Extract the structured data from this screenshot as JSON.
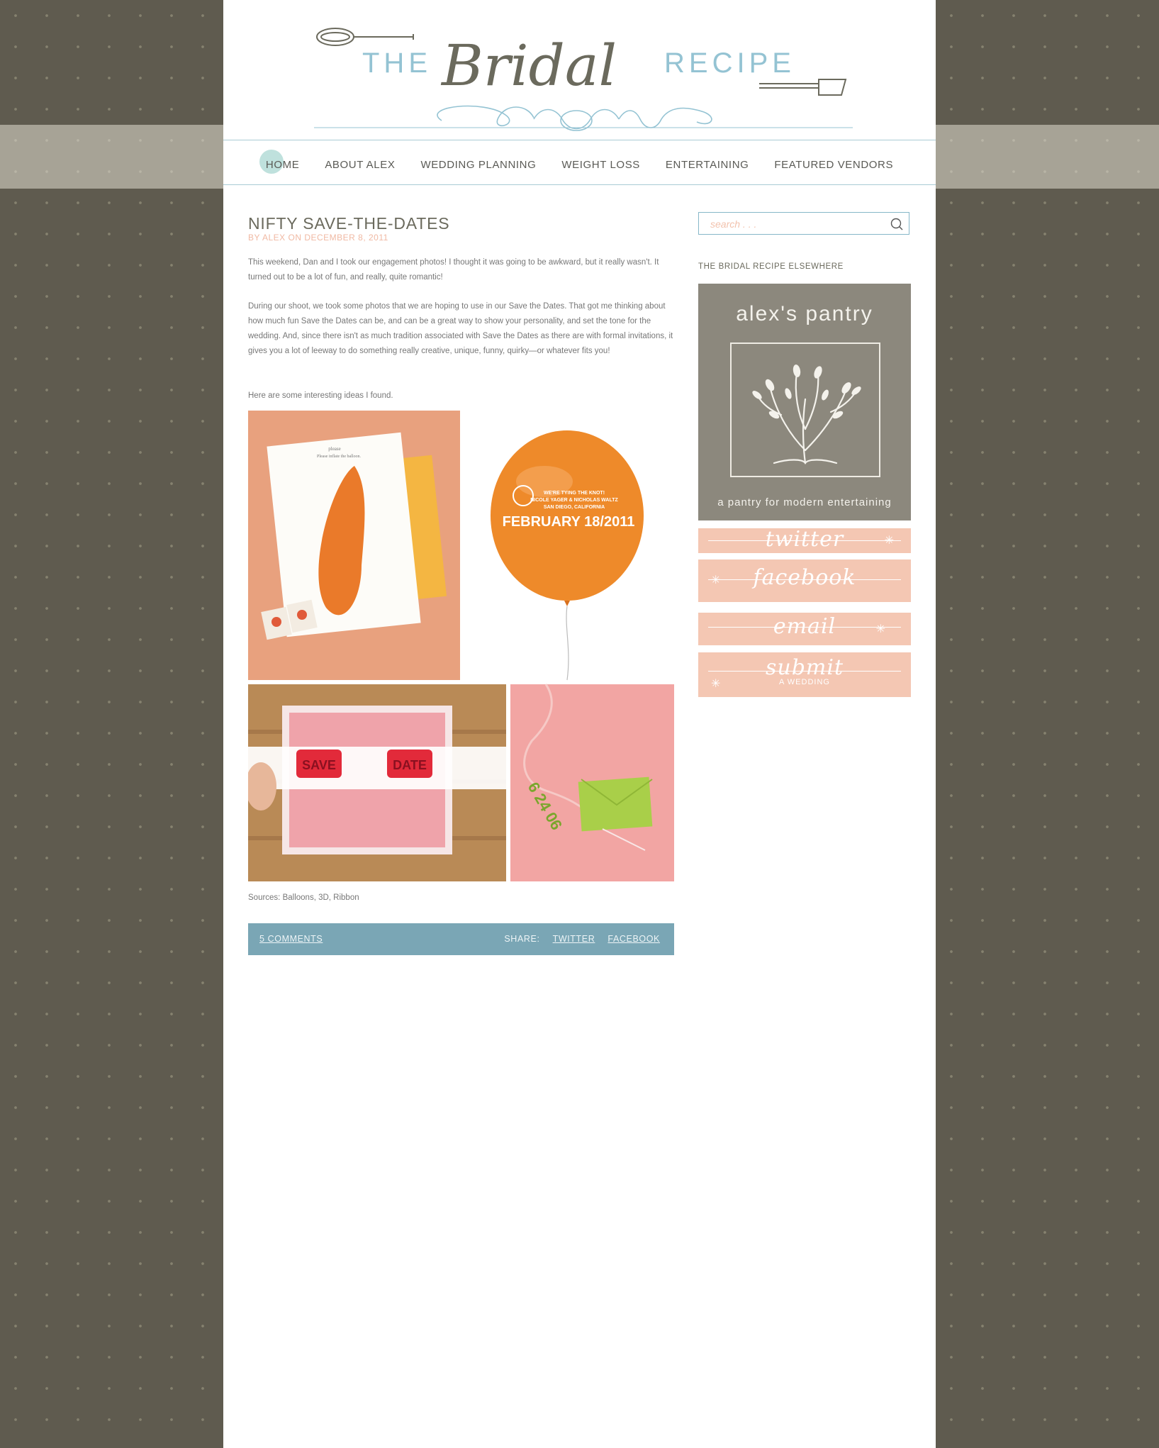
{
  "site": {
    "title_left": "THE",
    "title_script": "Bridal",
    "title_right": "RECIPE"
  },
  "nav": {
    "items": [
      {
        "label": "HOME"
      },
      {
        "label": "ABOUT ALEX"
      },
      {
        "label": "WEDDING PLANNING"
      },
      {
        "label": "WEIGHT LOSS"
      },
      {
        "label": "ENTERTAINING"
      },
      {
        "label": "FEATURED VENDORS"
      }
    ]
  },
  "post": {
    "title": "NIFTY SAVE-THE-DATES",
    "byline": "BY ALEX ON DECEMBER 8, 2011",
    "paragraphs": [
      "This weekend, Dan and I took our engagement photos! I thought it was going to be awkward, but it really wasn't. It turned out to be a lot of fun, and really, quite romantic!",
      "During our shoot, we took some photos that we are hoping to use in our Save the Dates. That got me thinking about how much fun Save the Dates can be, and can be a great way to show your personality, and set the tone for the wedding. And, since there isn't as much tradition associated with Save the Dates as there are with formal invitations, it gives you a lot of leeway to do something really creative, unique, funny, quirky—or whatever fits you!",
      "Here are some interesting ideas I found."
    ],
    "photos": {
      "balloon_card_line1": "please",
      "balloon_card_line2": "Please inflate the balloon.",
      "balloon_text_1": "WE'RE TYING THE KNOT!",
      "balloon_text_2": "NICOLE YAGER & NICHOLAS WALTZ",
      "balloon_text_3": "SAN DIEGO, CALIFORNIA",
      "balloon_date": "FEBRUARY 18/2011",
      "glasses_left": "SAVE",
      "glasses_right": "DATE",
      "ribbon_date": "6 24 06"
    },
    "sources": "Sources: Balloons, 3D, Ribbon",
    "comments_label": "5 COMMENTS",
    "share_label": "SHARE:",
    "share_twitter": "TWITTER",
    "share_facebook": "FACEBOOK"
  },
  "sidebar": {
    "search_placeholder": "search . . .",
    "heading": "THE BRIDAL RECIPE ELSEWHERE",
    "pantry_name": "alex's pantry",
    "pantry_tagline": "a pantry for modern entertaining",
    "buttons": {
      "twitter": "twitter",
      "facebook": "facebook",
      "email": "email",
      "submit": "submit",
      "submit_sub": "A WEDDING"
    }
  },
  "colors": {
    "background": "#5f5b4f",
    "accent_blue": "#7aa6b5",
    "peach": "#f4c7b3",
    "pantry_gray": "#8c887d",
    "nav_highlight": "#bfe1dd"
  }
}
